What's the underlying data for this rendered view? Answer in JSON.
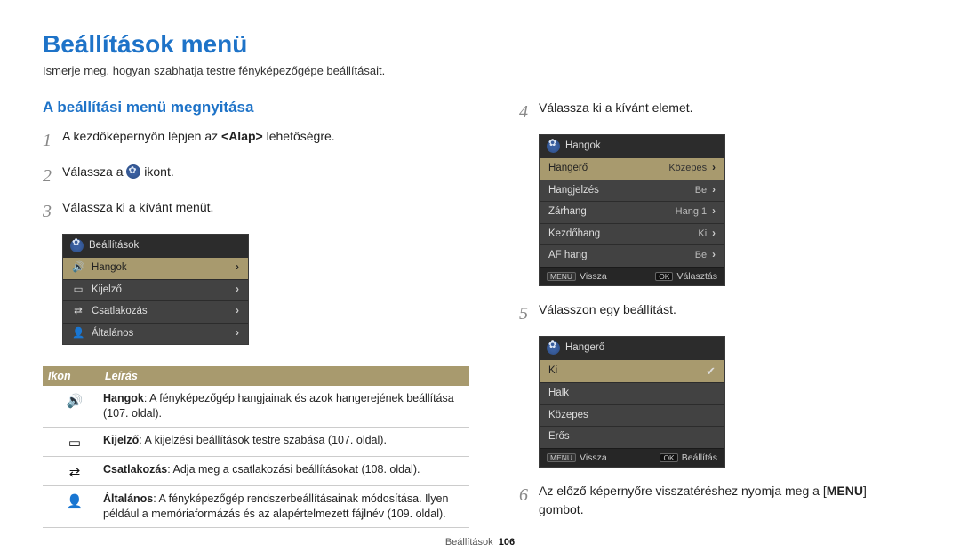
{
  "page_title": "Beállítások menü",
  "intro": "Ismerje meg, hogyan szabhatja testre fényképezőgépe beállításait.",
  "section_title": "A beállítási menü megnyitása",
  "steps": {
    "1": {
      "pre": "A kezdőképernyőn lépjen az ",
      "bold": "<Alap>",
      "post": " lehetőségre."
    },
    "2": {
      "pre": "Válassza a ",
      "post": " ikont."
    },
    "3": "Válassza ki a kívánt menüt.",
    "4": "Válassza ki a kívánt elemet.",
    "5": "Válasszon egy beállítást.",
    "6": {
      "pre": "Az előző képernyőre visszatéréshez nyomja meg a [",
      "bold": "MENU",
      "post": "] gombot."
    }
  },
  "lcd_settings": {
    "title": "Beállítások",
    "rows": [
      {
        "icon": "🔊",
        "label": "Hangok",
        "selected": true,
        "name": "sound"
      },
      {
        "icon": "▭",
        "label": "Kijelző",
        "name": "display"
      },
      {
        "icon": "⇄",
        "label": "Csatlakozás",
        "name": "connect"
      },
      {
        "icon": "👤",
        "label": "Általános",
        "name": "general"
      }
    ]
  },
  "lcd_sound": {
    "title": "Hangok",
    "rows": [
      {
        "label": "Hangerő",
        "value": "Közepes",
        "chev": true,
        "selected": true,
        "name": "volume"
      },
      {
        "label": "Hangjelzés",
        "value": "Be",
        "chev": true,
        "name": "beep"
      },
      {
        "label": "Zárhang",
        "value": "Hang 1",
        "chev": true,
        "name": "shutter"
      },
      {
        "label": "Kezdőhang",
        "value": "Ki",
        "chev": true,
        "name": "startup"
      },
      {
        "label": "AF hang",
        "value": "Be",
        "chev": true,
        "name": "af"
      }
    ],
    "bottom_left_btn": "MENU",
    "bottom_left_label": "Vissza",
    "bottom_right_btn": "OK",
    "bottom_right_label": "Választás"
  },
  "lcd_volume": {
    "title": "Hangerő",
    "rows": [
      {
        "label": "Ki",
        "selected": true,
        "check": true,
        "name": "off"
      },
      {
        "label": "Halk",
        "name": "low"
      },
      {
        "label": "Közepes",
        "name": "medium"
      },
      {
        "label": "Erős",
        "name": "high"
      }
    ],
    "bottom_left_btn": "MENU",
    "bottom_left_label": "Vissza",
    "bottom_right_btn": "OK",
    "bottom_right_label": "Beállítás"
  },
  "icon_table": {
    "col1": "Ikon",
    "col2": "Leírás",
    "rows": [
      {
        "icon": "🔊",
        "bold": "Hangok",
        "desc": ": A fényképezőgép hangjainak és azok hangerejének beállítása (107. oldal)."
      },
      {
        "icon": "▭",
        "bold": "Kijelző",
        "desc": ": A kijelzési beállítások testre szabása (107. oldal)."
      },
      {
        "icon": "⇄",
        "bold": "Csatlakozás",
        "desc": ": Adja meg a csatlakozási beállításokat (108. oldal)."
      },
      {
        "icon": "👤",
        "bold": "Általános",
        "desc": ": A fényképezőgép rendszerbeállításainak módosítása. Ilyen például a memóriaformázás és az alapértelmezett fájlnév (109. oldal)."
      }
    ]
  },
  "footer": {
    "section": "Beállítások",
    "page": "106"
  }
}
